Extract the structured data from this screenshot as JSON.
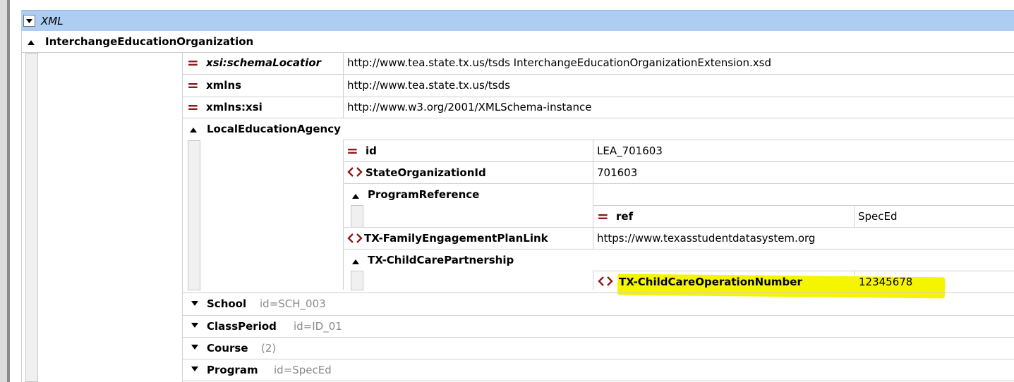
{
  "header": {
    "title": "XML"
  },
  "root": {
    "name": "InterchangeEducationOrganization"
  },
  "root_attributes": [
    {
      "name": "xsi:schemaLocatior",
      "value": "http://www.tea.state.tx.us/tsds InterchangeEducationOrganizationExtension.xsd"
    },
    {
      "name": "xmlns",
      "value": "http://www.tea.state.tx.us/tsds"
    },
    {
      "name": "xmlns:xsi",
      "value": "http://www.w3.org/2001/XMLSchema-instance"
    }
  ],
  "lea": {
    "name": "LocalEducationAgency",
    "id_label": "id",
    "id_value": "LEA_701603",
    "state_org_label": "StateOrganizationId",
    "state_org_value": "701603",
    "program_ref": {
      "name": "ProgramReference",
      "ref_label": "ref",
      "ref_value": "SpecEd"
    },
    "family_link_label": "TX-FamilyEngagementPlanLink",
    "family_link_value": "https://www.texasstudentdatasystem.org",
    "childcare": {
      "name": "TX-ChildCarePartnership",
      "op_label": "TX-ChildCareOperationNumber",
      "op_value": "12345678"
    }
  },
  "collapsed_elements": [
    {
      "name": "School",
      "detail": "id=SCH_003"
    },
    {
      "name": "ClassPeriod",
      "detail": "id=ID_01"
    },
    {
      "name": "Course",
      "detail": "(2)"
    },
    {
      "name": "Program",
      "detail": "id=SpecEd"
    }
  ],
  "colors": {
    "header_bg": "#aecdf2",
    "highlight": "#f5f500",
    "attribute_icon": "#8b1a1a"
  }
}
